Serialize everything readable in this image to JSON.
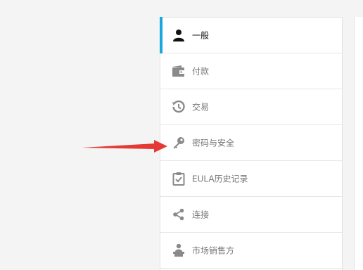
{
  "menu": {
    "items": [
      {
        "label": "一般",
        "icon": "user-icon",
        "active": true
      },
      {
        "label": "付款",
        "icon": "wallet-icon",
        "active": false
      },
      {
        "label": "交易",
        "icon": "history-icon",
        "active": false
      },
      {
        "label": "密码与安全",
        "icon": "key-icon",
        "active": false
      },
      {
        "label": "EULA历史记录",
        "icon": "clipboard-check-icon",
        "active": false
      },
      {
        "label": "连接",
        "icon": "share-icon",
        "active": false
      },
      {
        "label": "市场销售方",
        "icon": "seller-icon",
        "active": false
      }
    ]
  },
  "colors": {
    "active_accent": "#1aa7e0",
    "icon_gray": "#8a8a8a",
    "annotation_arrow": "#e53935"
  }
}
